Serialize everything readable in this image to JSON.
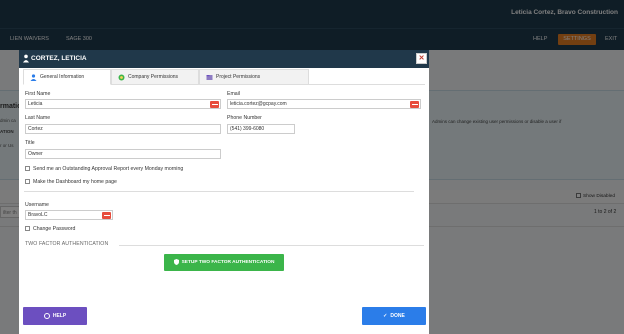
{
  "header": {
    "user_company": "Leticia Cortez, Bravo Construction"
  },
  "nav": {
    "left": [
      "LIEN WAIVERS",
      "SAGE 300"
    ],
    "help": "HELP",
    "settings": "SETTINGS",
    "exit": "EXIT"
  },
  "background": {
    "title_partial": "rmatio",
    "info_line1": "rmatio",
    "info_line2": "dmin ca",
    "info_line3": "ATION",
    "info_line4": "r or Us",
    "info_right": "Admins can change existing user permissions or disable a user if",
    "show_disabled": "Show Disabled",
    "filter_placeholder": "ilter th",
    "count": "1 to 2 of 2"
  },
  "modal": {
    "title": "CORTEZ, LETICIA",
    "tabs": [
      "General Information",
      "Company Permissions",
      "Project Permissions"
    ],
    "fields": {
      "first_name_label": "First Name",
      "first_name": "Leticia",
      "email_label": "Email",
      "email": "leticia.cortez@gcpay.com",
      "last_name_label": "Last Name",
      "last_name": "Cortez",
      "phone_label": "Phone Number",
      "phone": "(541) 399-6080",
      "title_label": "Title",
      "title": "Owner",
      "username_label": "Username",
      "username": "BravoLC"
    },
    "checkboxes": {
      "report": "Send me an Outstanding Approval Report every Monday morning",
      "dashboard": "Make the Dashboard my home page",
      "change_password": "Change Password"
    },
    "two_factor_heading": "TWO FACTOR AUTHENTICATION",
    "two_factor_button": "SETUP TWO FACTOR AUTHENTICATION",
    "help_button": "HELP",
    "done_button": "DONE"
  },
  "colors": {
    "header_bg": "#1f3a4d",
    "settings_accent": "#e67e22",
    "required": "#e74c3c",
    "twofa_green": "#3bb54a",
    "help_purple": "#6c4fc0",
    "done_blue": "#2b7de9"
  }
}
